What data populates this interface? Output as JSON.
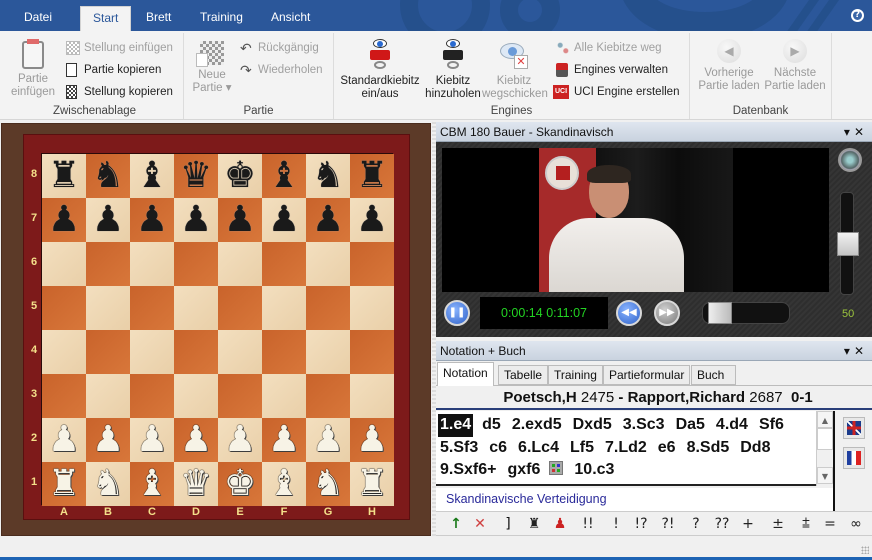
{
  "menu": {
    "tabs": [
      {
        "label": "Datei",
        "active": false
      },
      {
        "label": "Start",
        "active": true
      },
      {
        "label": "Brett",
        "active": false
      },
      {
        "label": "Training",
        "active": false
      },
      {
        "label": "Ansicht",
        "active": false
      }
    ],
    "help_icon": "help-icon"
  },
  "ribbon": {
    "zwischenablage": {
      "label": "Zwischenablage",
      "partie_einfuegen": "Partie einfügen",
      "stellung_einfuegen": "Stellung einfügen",
      "partie_kopieren": "Partie kopieren",
      "stellung_kopieren": "Stellung kopieren"
    },
    "partie": {
      "label": "Partie",
      "neue_partie": "Neue Partie",
      "rueckgaengig": "Rückgängig",
      "wiederholen": "Wiederholen"
    },
    "engines": {
      "label": "Engines",
      "standardkiebitz": "Standardkiebitz ein/aus",
      "kiebitz_hinzuholen": "Kiebitz hinzuholen",
      "kiebitz_wegschicken": "Kiebitz wegschicken",
      "alle_kiebitze_weg": "Alle Kiebitze weg",
      "engines_verwalten": "Engines verwalten",
      "uci_engine_erstellen": "UCI Engine erstellen"
    },
    "datenbank": {
      "label": "Datenbank",
      "vorherige": "Vorherige Partie laden",
      "naechste": "Nächste Partie laden"
    }
  },
  "board": {
    "ranks": [
      "8",
      "7",
      "6",
      "5",
      "4",
      "3",
      "2",
      "1"
    ],
    "files": [
      "A",
      "B",
      "C",
      "D",
      "E",
      "F",
      "G",
      "H"
    ],
    "position": [
      [
        "r",
        "n",
        "b",
        "q",
        "k",
        "b",
        "n",
        "r"
      ],
      [
        "p",
        "p",
        "p",
        "p",
        "p",
        "p",
        "p",
        "p"
      ],
      [
        "",
        "",
        "",
        "",
        "",
        "",
        "",
        ""
      ],
      [
        "",
        "",
        "",
        "",
        "",
        "",
        "",
        ""
      ],
      [
        "",
        "",
        "",
        "",
        "",
        "",
        "",
        ""
      ],
      [
        "",
        "",
        "",
        "",
        "",
        "",
        "",
        ""
      ],
      [
        "P",
        "P",
        "P",
        "P",
        "P",
        "P",
        "P",
        "P"
      ],
      [
        "R",
        "N",
        "B",
        "Q",
        "K",
        "B",
        "N",
        "R"
      ]
    ]
  },
  "video": {
    "title": "CBM 180 Bauer - Skandinavisch",
    "time_current": "0:00:14",
    "time_total": "0:11:07",
    "volume": 50,
    "seek_fraction": 0.02
  },
  "notation_pane": {
    "title": "Notation + Buch",
    "tabs": [
      {
        "label": "Notation",
        "active": true
      },
      {
        "label": "Tabelle",
        "active": false
      },
      {
        "label": "Training",
        "active": false
      },
      {
        "label": "Partieformular",
        "active": false
      },
      {
        "label": "Buch",
        "active": false
      }
    ],
    "header": {
      "white": "Poetsch,H",
      "white_elo": "2475",
      "separator": "-",
      "black": "Rapport,Richard",
      "black_elo": "2687",
      "result": "0-1"
    },
    "moves": [
      "1.e4",
      "d5",
      "2.exd5",
      "Dxd5",
      "3.Sc3",
      "Da5",
      "4.d4",
      "Sf6",
      "5.Sf3",
      "c6",
      "6.Lc4",
      "Lf5",
      "7.Ld2",
      "e6",
      "8.Sd5",
      "Dd8",
      "9.Sxf6+",
      "gxf6",
      "10.c3"
    ],
    "selected_move": "1.e4",
    "opening": "Skandinavische Verteidigung",
    "flags": [
      "flag-uk-icon",
      "flag-france-icon"
    ],
    "symbols": [
      "↑",
      "✕",
      "]",
      "♜",
      "♟",
      "!!",
      "!",
      "!?",
      "?!",
      "?",
      "??",
      "+−",
      "±",
      "⩲",
      "=",
      "∞"
    ]
  }
}
